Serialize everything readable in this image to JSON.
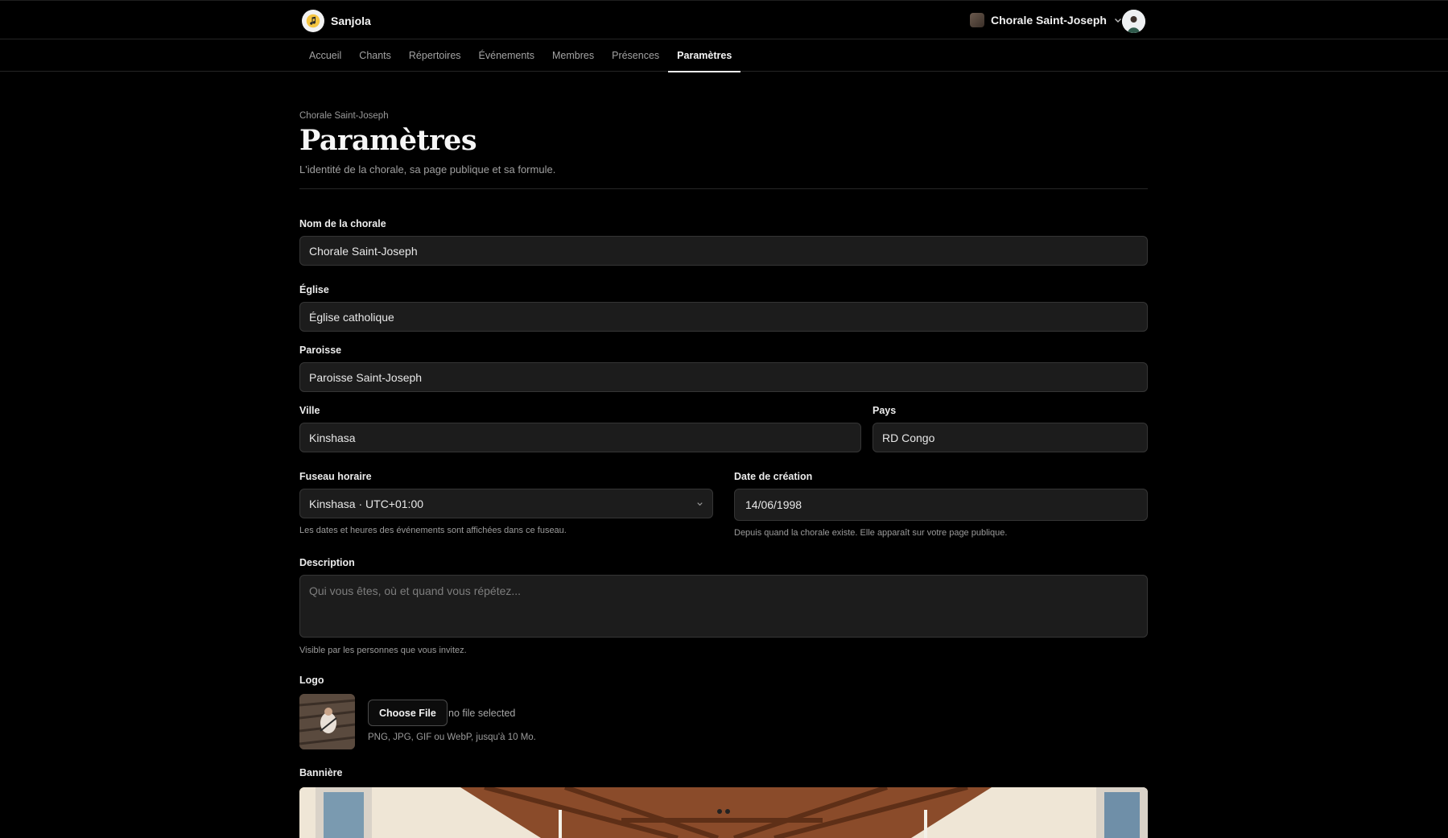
{
  "app": {
    "name": "Sanjola"
  },
  "org_switcher": {
    "name": "Chorale Saint-Joseph"
  },
  "nav": {
    "items": [
      {
        "label": "Accueil"
      },
      {
        "label": "Chants"
      },
      {
        "label": "Répertoires"
      },
      {
        "label": "Événements"
      },
      {
        "label": "Membres"
      },
      {
        "label": "Présences"
      },
      {
        "label": "Paramètres",
        "active": true
      }
    ]
  },
  "header": {
    "breadcrumb": "Chorale Saint-Joseph",
    "title": "Paramètres",
    "subtitle": "L'identité de la chorale, sa page publique et sa formule."
  },
  "form": {
    "name": {
      "label": "Nom de la chorale",
      "value": "Chorale Saint-Joseph"
    },
    "church": {
      "label": "Église",
      "value": "Église catholique"
    },
    "parish": {
      "label": "Paroisse",
      "value": "Paroisse Saint-Joseph"
    },
    "city": {
      "label": "Ville",
      "value": "Kinshasa"
    },
    "country": {
      "label": "Pays",
      "value": "RD Congo"
    },
    "timezone": {
      "label": "Fuseau horaire",
      "value": "Kinshasa · UTC+01:00",
      "hint": "Les dates et heures des événements sont affichées dans ce fuseau."
    },
    "created": {
      "label": "Date de création",
      "value": "14/06/1998",
      "hint": "Depuis quand la chorale existe. Elle apparaît sur votre page publique."
    },
    "description": {
      "label": "Description",
      "placeholder": "Qui vous êtes, où et quand vous répétez...",
      "hint": "Visible par les personnes que vous invitez."
    },
    "logo": {
      "label": "Logo",
      "button": "Choose File",
      "status": "no file selected",
      "hint": "PNG, JPG, GIF ou WebP, jusqu'à 10 Mo."
    },
    "banner": {
      "label": "Bannière"
    }
  },
  "colors": {
    "background": "#000000",
    "field_bg": "#1c1c1c",
    "field_border": "#353535",
    "accent": "#f5f5f5"
  }
}
